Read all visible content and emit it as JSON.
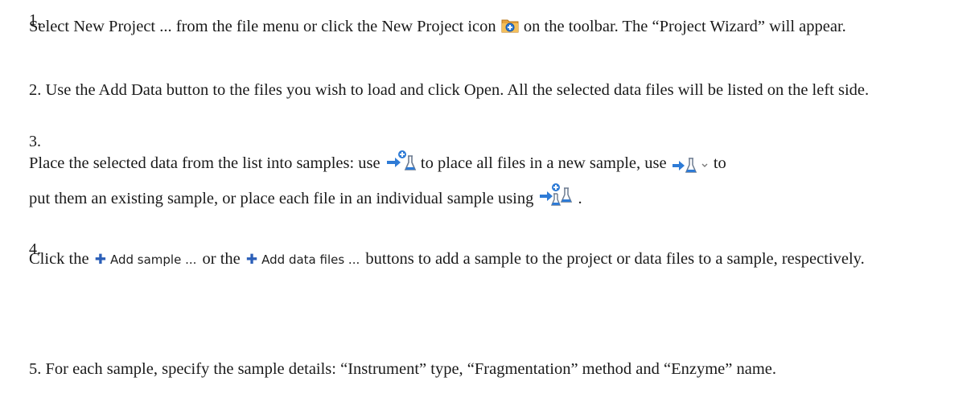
{
  "steps": [
    {
      "number": "1.",
      "text_a": "Select New Project ... from the file menu or click the New Project icon ",
      "text_b": " on the toolbar. The “Project Wizard” will appear.",
      "icon": "new-project-icon"
    },
    {
      "number": "2.",
      "text_a": "Use the Add Data button to the files you wish to load and click Open. All the selected data files will be listed on the left side."
    },
    {
      "number": "3.",
      "text_a": "Place the selected data from the list into samples: use ",
      "text_b": " to place all files in a new sample, use ",
      "text_c": " to",
      "text_d": "put them an existing sample, or place each file in an individual sample using ",
      "text_e": ".",
      "icons": [
        "add-to-new-sample-icon",
        "add-to-existing-sample-icon",
        "add-to-individual-samples-icon"
      ]
    },
    {
      "number": "4.",
      "text_a": "Click the ",
      "button1_label": "Add sample ...",
      "text_b": " or the ",
      "button2_label": "Add data files ...",
      "text_c": " buttons to add a sample to the project or data files to a sample, respectively."
    },
    {
      "number": "5.",
      "text_a": "For each sample, specify the sample details: “Instrument” type, “Fragmentation” method and “Enzyme” name."
    }
  ],
  "colors": {
    "accent_blue": "#2b5fb8",
    "arrow_blue": "#2e7bd6",
    "folder_orange": "#e8a33b",
    "text": "#1a1a1a"
  }
}
